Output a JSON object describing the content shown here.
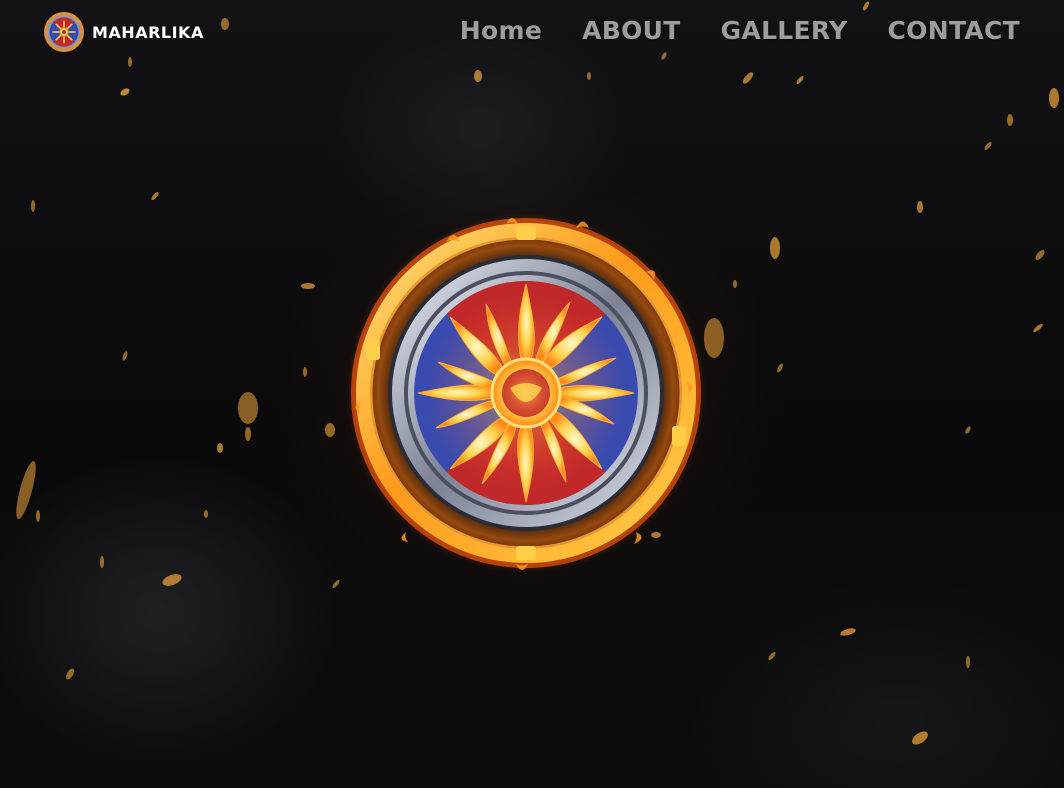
{
  "brand": {
    "name": "MAHARLIKA",
    "logo_icon": "sun-shield-logo-icon"
  },
  "nav": {
    "items": [
      {
        "label": "Home"
      },
      {
        "label": "ABOUT"
      },
      {
        "label": "GALLERY"
      },
      {
        "label": "CONTACT"
      }
    ]
  },
  "hero": {
    "emblem_icon": "flaming-sun-shield-icon"
  },
  "colors": {
    "background": "#0b0b0c",
    "nav_text": "#9d9d9d",
    "brand_text": "#ffffff",
    "fire": "#ff8a1a",
    "shield_blue": "#3a4bb0",
    "shield_red": "#c0282a",
    "sun": "#ffd24a"
  }
}
